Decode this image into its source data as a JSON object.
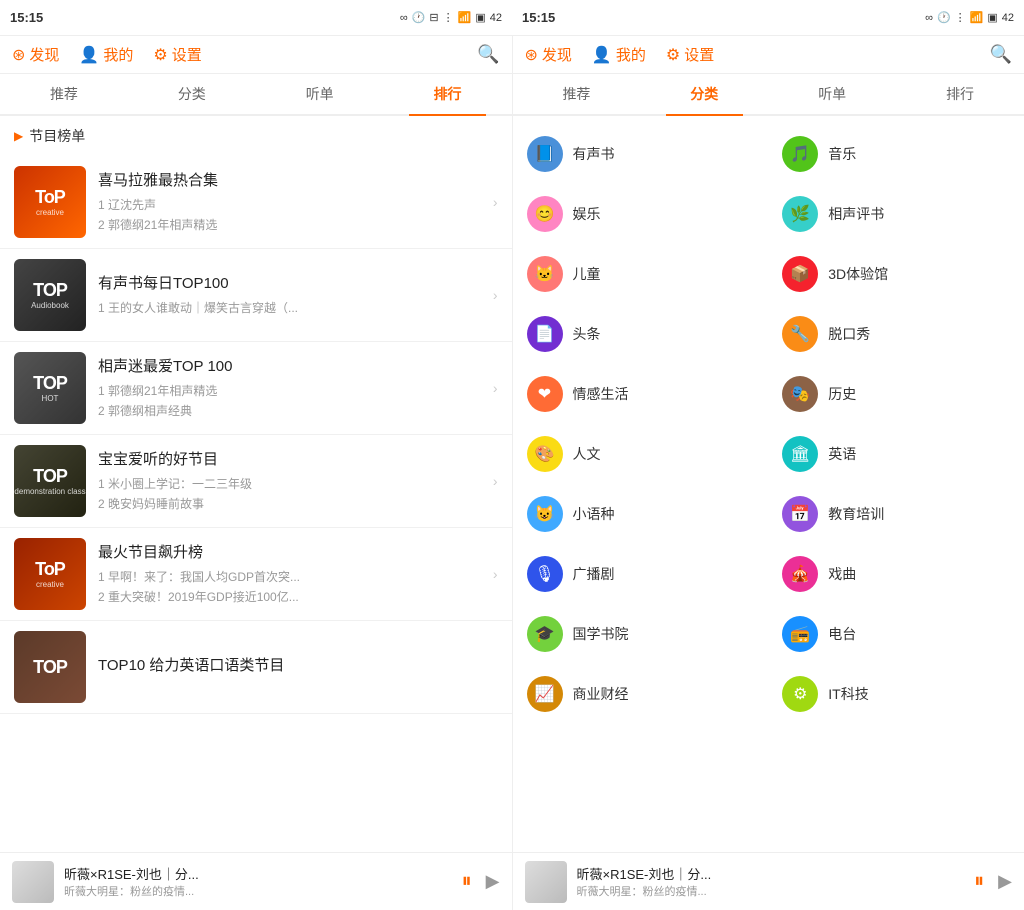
{
  "statusBar": {
    "leftTime": "15:15",
    "leftBattery": "42",
    "rightTime": "15:15",
    "rightBattery": "42"
  },
  "leftPanel": {
    "nav": {
      "discover": "发现",
      "mine": "我的",
      "settings": "设置"
    },
    "tabs": [
      "推荐",
      "分类",
      "听单",
      "排行"
    ],
    "activeTab": "排行",
    "sectionTitle": "节目榜单",
    "items": [
      {
        "title": "喜马拉雅最热合集",
        "sub1": "1 辽沈先声",
        "sub2": "2 郭德纲21年相声精选",
        "thumbClass": "thumb-orange"
      },
      {
        "title": "有声书每日TOP100",
        "sub1": "1 王的女人谁敢动｜爆笑古言穿越（...",
        "sub2": "",
        "thumbClass": "thumb-dark"
      },
      {
        "title": "相声迷最爱TOP 100",
        "sub1": "1 郭德纲21年相声精选",
        "sub2": "2 郭德纲相声经典",
        "thumbClass": "thumb-gray"
      },
      {
        "title": "宝宝爱听的好节目",
        "sub1": "1 米小圈上学记：一二三年级",
        "sub2": "2 晚安妈妈睡前故事",
        "thumbClass": "thumb-darkblue"
      },
      {
        "title": "最火节目飙升榜",
        "sub1": "1 早啊！来了：我国人均GDP首次突...",
        "sub2": "2 重大突破！2019年GDP接近100亿...",
        "thumbClass": "thumb-fire"
      },
      {
        "title": "TOP10 给力英语口语类节目",
        "sub1": "",
        "sub2": "",
        "thumbClass": "thumb-bottom"
      }
    ],
    "player": {
      "title": "昕薇×R1SE-刘也｜分...",
      "sub": "昕薇大明星：粉丝的疫情..."
    }
  },
  "rightPanel": {
    "nav": {
      "discover": "发现",
      "mine": "我的",
      "settings": "设置"
    },
    "tabs": [
      "推荐",
      "分类",
      "听单",
      "排行"
    ],
    "activeTab": "分类",
    "categories": [
      {
        "label": "有声书",
        "icon": "📘",
        "iconClass": "ic-blue"
      },
      {
        "label": "音乐",
        "icon": "🎵",
        "iconClass": "ic-green"
      },
      {
        "label": "娱乐",
        "icon": "😊",
        "iconClass": "ic-pink"
      },
      {
        "label": "相声评书",
        "icon": "🌿",
        "iconClass": "ic-teal"
      },
      {
        "label": "儿童",
        "icon": "🐱",
        "iconClass": "ic-salmon"
      },
      {
        "label": "3D体验馆",
        "icon": "📦",
        "iconClass": "ic-red"
      },
      {
        "label": "头条",
        "icon": "📄",
        "iconClass": "ic-purple"
      },
      {
        "label": "脱口秀",
        "icon": "🔧",
        "iconClass": "ic-orange"
      },
      {
        "label": "情感生活",
        "icon": "❤",
        "iconClass": "ic-coral"
      },
      {
        "label": "历史",
        "icon": "🎭",
        "iconClass": "ic-brown"
      },
      {
        "label": "人文",
        "icon": "🎨",
        "iconClass": "ic-yellow"
      },
      {
        "label": "英语",
        "icon": "🏛",
        "iconClass": "ic-cyan"
      },
      {
        "label": "小语种",
        "icon": "😺",
        "iconClass": "ic-lightblue"
      },
      {
        "label": "教育培训",
        "icon": "📅",
        "iconClass": "ic-violet"
      },
      {
        "label": "广播剧",
        "icon": "🎙",
        "iconClass": "ic-deepblue"
      },
      {
        "label": "戏曲",
        "icon": "🎪",
        "iconClass": "ic-magenta"
      },
      {
        "label": "国学书院",
        "icon": "🎓",
        "iconClass": "ic-grass"
      },
      {
        "label": "电台",
        "icon": "📻",
        "iconClass": "ic-navy"
      },
      {
        "label": "商业财经",
        "icon": "📈",
        "iconClass": "ic-gold"
      },
      {
        "label": "IT科技",
        "icon": "⚙",
        "iconClass": "ic-lime"
      }
    ],
    "player": {
      "title": "昕薇×R1SE-刘也｜分...",
      "sub": "昕薇大明星：粉丝的疫情..."
    }
  }
}
